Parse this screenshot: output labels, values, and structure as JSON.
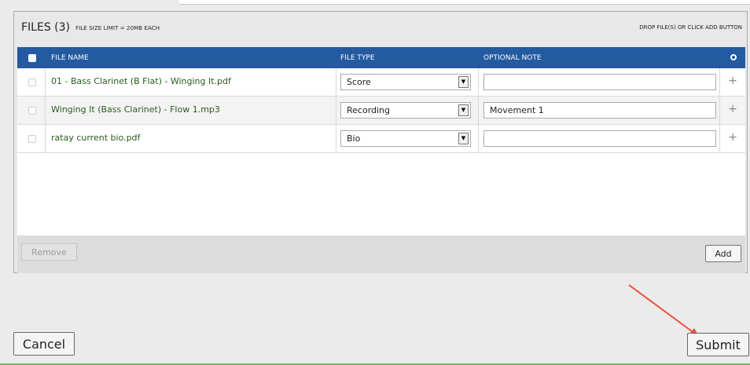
{
  "files": {
    "title": "FILES (3)",
    "size_limit": "FILE SIZE LIMIT = 20MB EACH",
    "drop_hint": "DROP FILE(S) OR CLICK ADD BUTTON",
    "columns": {
      "file_name": "FILE NAME",
      "file_type": "FILE TYPE",
      "optional_note": "OPTIONAL NOTE"
    },
    "rows": [
      {
        "name": "01 - Bass Clarinet (B Flat) - Winging It.pdf",
        "type": "Score",
        "note": "",
        "plus": "+"
      },
      {
        "name": "Winging It (Bass Clarinet) - Flow 1.mp3",
        "type": "Recording",
        "note": "Movement 1",
        "plus": "+"
      },
      {
        "name": "ratay current bio.pdf",
        "type": "Bio",
        "note": "",
        "plus": "+"
      }
    ],
    "remove_label": "Remove",
    "add_label": "Add"
  },
  "actions": {
    "cancel_label": "Cancel",
    "submit_label": "Submit"
  },
  "colors": {
    "header_blue": "#245aa0",
    "filename_green": "#2a5b1e",
    "annotation_red": "#e8503a"
  },
  "icons": {
    "select_arrow": "▼"
  }
}
